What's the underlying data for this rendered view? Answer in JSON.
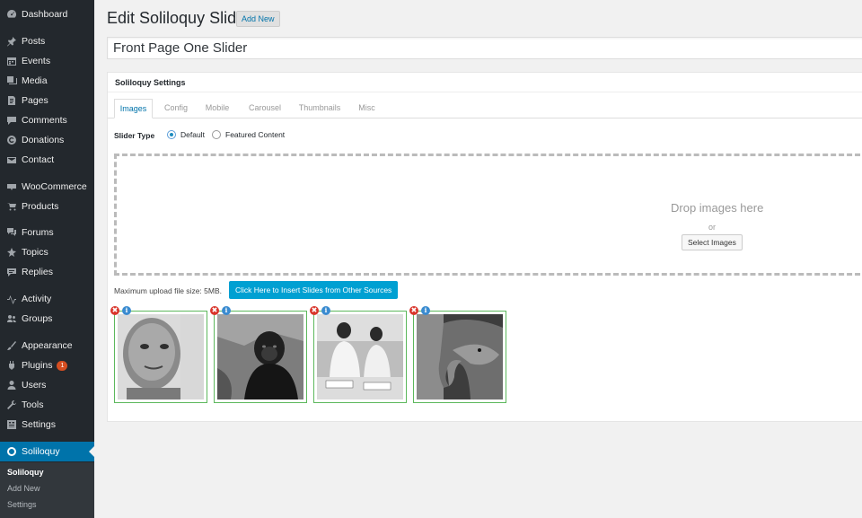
{
  "sidebar": {
    "items": [
      {
        "label": "Dashboard",
        "icon": "dashboard-icon"
      },
      {
        "label": "Posts",
        "icon": "pin-icon"
      },
      {
        "label": "Events",
        "icon": "calendar-icon"
      },
      {
        "label": "Media",
        "icon": "media-icon"
      },
      {
        "label": "Pages",
        "icon": "pages-icon"
      },
      {
        "label": "Comments",
        "icon": "comments-icon"
      },
      {
        "label": "Donations",
        "icon": "donations-icon"
      },
      {
        "label": "Contact",
        "icon": "mail-icon"
      },
      {
        "label": "WooCommerce",
        "icon": "woocommerce-icon"
      },
      {
        "label": "Products",
        "icon": "cart-icon"
      },
      {
        "label": "Forums",
        "icon": "forums-icon"
      },
      {
        "label": "Topics",
        "icon": "topics-icon"
      },
      {
        "label": "Replies",
        "icon": "replies-icon"
      },
      {
        "label": "Activity",
        "icon": "activity-icon"
      },
      {
        "label": "Groups",
        "icon": "groups-icon"
      },
      {
        "label": "Appearance",
        "icon": "brush-icon"
      },
      {
        "label": "Plugins",
        "icon": "plug-icon",
        "badge": "1"
      },
      {
        "label": "Users",
        "icon": "user-icon"
      },
      {
        "label": "Tools",
        "icon": "wrench-icon"
      },
      {
        "label": "Settings",
        "icon": "settings-icon"
      },
      {
        "label": "Soliloquy",
        "icon": "soliloquy-icon",
        "current": true
      }
    ],
    "submenu": [
      "Soliloquy",
      "Add New",
      "Settings"
    ]
  },
  "header": {
    "title": "Edit Soliloquy Slider",
    "add_new": "Add New"
  },
  "post_title": "Front Page One Slider",
  "settings": {
    "title": "Soliloquy Settings",
    "tabs": [
      "Images",
      "Config",
      "Mobile",
      "Carousel",
      "Thumbnails",
      "Misc"
    ],
    "active_tab": "Images",
    "slider_type_label": "Slider Type",
    "slider_types": [
      "Default",
      "Featured Content"
    ],
    "selected_slider_type": "Default"
  },
  "dropzone": {
    "drop_text": "Drop images here",
    "or_text": "or",
    "select_button": "Select Images"
  },
  "upload": {
    "max_size_text": "Maximum upload file size: 5MB.",
    "insert_button": "Click Here to Insert Slides from Other Sources"
  },
  "slides": [
    {
      "subject": "child portrait",
      "remove": "✖",
      "info": "i"
    },
    {
      "subject": "gorilla",
      "remove": "✖",
      "info": "i"
    },
    {
      "subject": "volunteers",
      "remove": "✖",
      "info": "i"
    },
    {
      "subject": "elephant",
      "remove": "✖",
      "info": "i"
    }
  ],
  "colors": {
    "sidebar_bg": "#23282d",
    "accent": "#0073aa",
    "button_blue": "#00a0d2",
    "slide_border": "#5cb85c",
    "remove_red": "#d9352b",
    "info_blue": "#3a8bd0"
  }
}
